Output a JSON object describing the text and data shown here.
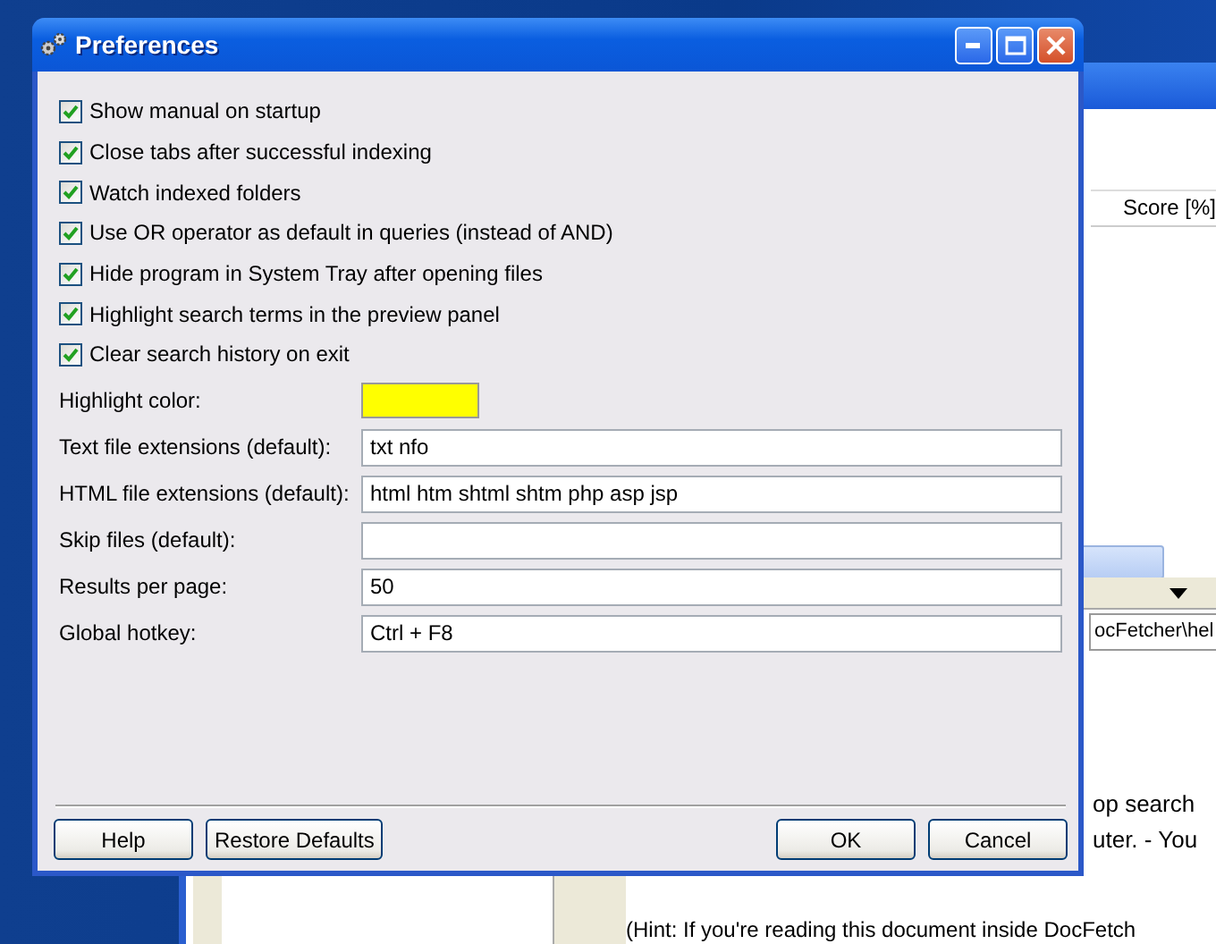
{
  "window": {
    "title": "Preferences"
  },
  "checkboxes": [
    {
      "label": "Show manual on startup",
      "checked": true
    },
    {
      "label": "Close tabs after successful indexing",
      "checked": true
    },
    {
      "label": "Watch indexed folders",
      "checked": true
    },
    {
      "label": "Use OR operator as default in queries (instead of AND)",
      "checked": true
    },
    {
      "label": "Hide program in System Tray after opening files",
      "checked": true
    },
    {
      "label": "Highlight search terms in the preview panel",
      "checked": true
    },
    {
      "label": "Clear search history on exit",
      "checked": true
    }
  ],
  "fields": [
    {
      "label": "Highlight color:",
      "kind": "color",
      "color": "#ffff00"
    },
    {
      "label": "Text file extensions (default):",
      "kind": "text",
      "value": "txt nfo"
    },
    {
      "label": "HTML file extensions (default):",
      "kind": "text",
      "value": "html htm shtml shtm php asp jsp"
    },
    {
      "label": "Skip files (default):",
      "kind": "text"
    },
    {
      "label": "Results per page:",
      "kind": "text",
      "value": "50"
    },
    {
      "label": "Global hotkey:",
      "kind": "text",
      "value": "Ctrl + F8"
    }
  ],
  "buttons_left": [
    "Help",
    "Restore Defaults"
  ],
  "buttons_right": [
    "OK",
    "Cancel"
  ],
  "background_window": {
    "column_header": "Score [%]",
    "path": "ocFetcher\\hel",
    "preview_lines": [
      "op search",
      "uter. - You"
    ],
    "hint": "(Hint: If you're reading this document inside DocFetch"
  }
}
